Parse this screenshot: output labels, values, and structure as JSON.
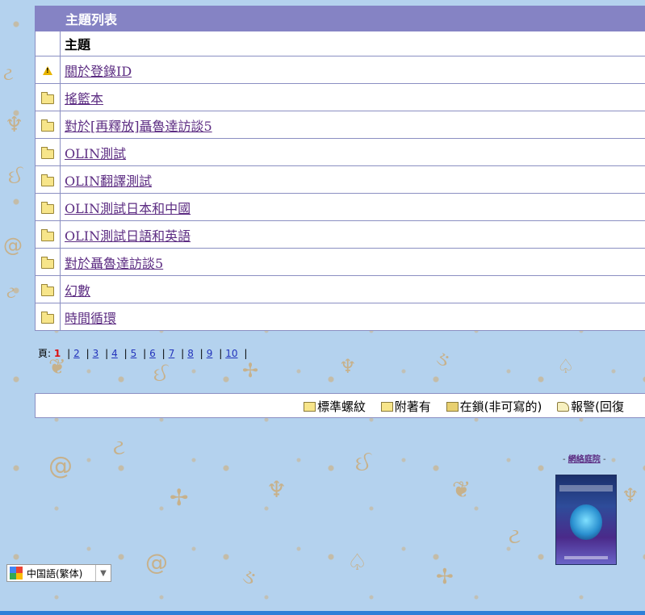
{
  "topic_list": {
    "header": "主題列表",
    "column_title": "主題",
    "rows": [
      {
        "icon": "warning-icon",
        "title": "關於登錄ID"
      },
      {
        "icon": "folder-icon",
        "title": "搖籃本"
      },
      {
        "icon": "folder-icon",
        "title": "對於[再釋放]聶魯達訪談5"
      },
      {
        "icon": "folder-icon",
        "title": "OLIN測試"
      },
      {
        "icon": "folder-icon",
        "title": "OLIN翻譯測試"
      },
      {
        "icon": "folder-icon",
        "title": "OLIN測試日本和中國"
      },
      {
        "icon": "folder-icon",
        "title": "OLIN測試日語和英語"
      },
      {
        "icon": "folder-icon",
        "title": "對於聶魯達訪談5"
      },
      {
        "icon": "folder-icon",
        "title": "幻數"
      },
      {
        "icon": "folder-icon",
        "title": "時間循環"
      }
    ]
  },
  "pager": {
    "label": "頁:",
    "current": "1",
    "pages": [
      "2",
      "3",
      "4",
      "5",
      "6",
      "7",
      "8",
      "9",
      "10"
    ]
  },
  "legend": {
    "items": [
      {
        "icon": "folder-icon",
        "label": "標準螺紋"
      },
      {
        "icon": "attachment-icon",
        "label": "附著有"
      },
      {
        "icon": "lock-icon",
        "label": "在鎖(非可寫的)"
      },
      {
        "icon": "alarm-icon",
        "label": "報警(回復"
      }
    ]
  },
  "side": {
    "link_prefix": "-",
    "link_label": "網絡庭院",
    "link_suffix": "-"
  },
  "translate": {
    "language": "中国語(繁体)",
    "arrow": "▼"
  },
  "colors": {
    "background": "#b4d2ee",
    "header_bar": "#8583c4",
    "link": "#5c2c82",
    "current_page": "#dd1111"
  }
}
